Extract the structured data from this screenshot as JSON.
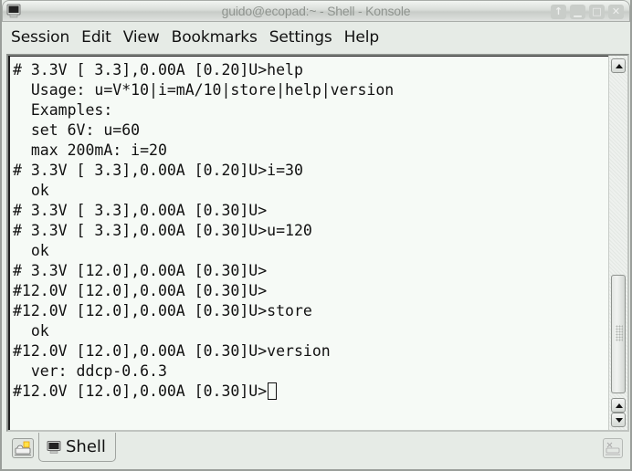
{
  "window": {
    "title": "guido@ecopad:~ - Shell - Konsole",
    "icon": "terminal-icon",
    "controls": [
      {
        "name": "keep-above",
        "glyph": "↑"
      },
      {
        "name": "minimize",
        "glyph": "▁"
      },
      {
        "name": "maximize",
        "glyph": "□"
      },
      {
        "name": "close",
        "glyph": "✕"
      }
    ]
  },
  "menubar": {
    "items": [
      "Session",
      "Edit",
      "View",
      "Bookmarks",
      "Settings",
      "Help"
    ]
  },
  "terminal": {
    "lines": [
      "# 3.3V [ 3.3],0.00A [0.20]U>help",
      "  Usage: u=V*10|i=mA/10|store|help|version",
      "  Examples:",
      "  set 6V: u=60",
      "  max 200mA: i=20",
      "# 3.3V [ 3.3],0.00A [0.20]U>i=30",
      "  ok",
      "# 3.3V [ 3.3],0.00A [0.30]U>",
      "# 3.3V [ 3.3],0.00A [0.30]U>u=120",
      "  ok",
      "# 3.3V [12.0],0.00A [0.30]U>",
      "#12.0V [12.0],0.00A [0.30]U>",
      "#12.0V [12.0],0.00A [0.30]U>store",
      "  ok",
      "#12.0V [12.0],0.00A [0.30]U>version",
      "  ver: ddcp-0.6.3"
    ],
    "prompt_line": "#12.0V [12.0],0.00A [0.30]U>",
    "scroll_position_fraction": 1.0
  },
  "tabs": {
    "new_tab_icon": "new-session-icon",
    "items": [
      {
        "label": "Shell",
        "icon": "terminal-icon",
        "active": true
      }
    ],
    "close_tab_icon": "close-session-icon"
  }
}
